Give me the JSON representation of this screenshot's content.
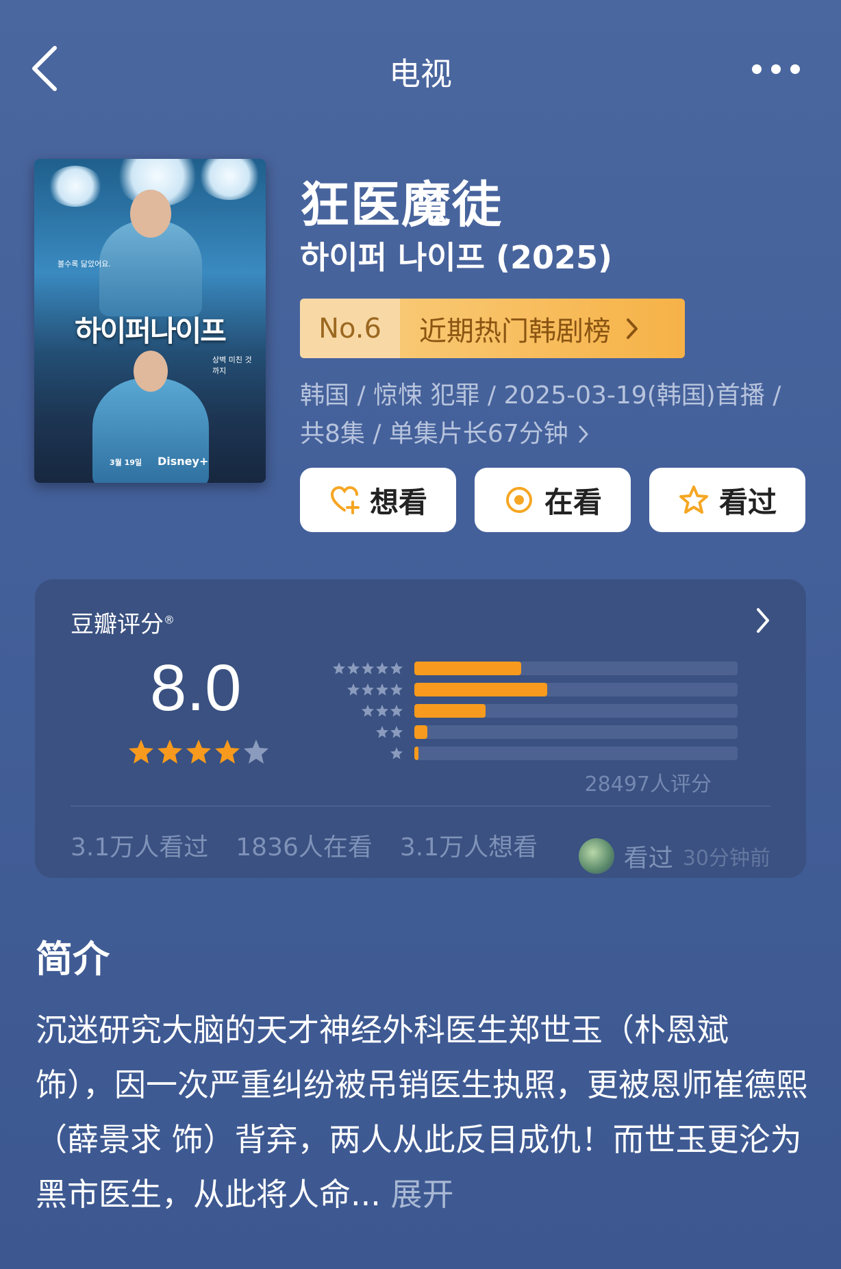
{
  "header": {
    "title": "电视"
  },
  "poster": {
    "title": "하이퍼나이프",
    "tagline_left": "볼수록 닮았어요.",
    "tagline_right": "상벽 미친 것까지",
    "date": "3월 19일",
    "brand": "Disney+"
  },
  "show": {
    "cn_title": "狂医魔徒",
    "original_title": "하이퍼 나이프 (2025)",
    "rank_no": "No.6",
    "rank_label": "近期热门韩剧榜",
    "meta_line1": "韩国 / 惊悚 犯罪 / 2025-03-19(韩国)首播 /",
    "meta_line2": "共8集 / 单集片长67分钟"
  },
  "actions": [
    {
      "label": "想看",
      "icon": "heart-plus-icon"
    },
    {
      "label": "在看",
      "icon": "target-icon"
    },
    {
      "label": "看过",
      "icon": "star-outline-icon"
    }
  ],
  "rating": {
    "label": "豆瓣评分",
    "mark": "®",
    "score": "8.0",
    "stars_filled": 4,
    "stars_total": 5,
    "distribution": [
      {
        "stars": 5,
        "fraction": 0.33
      },
      {
        "stars": 4,
        "fraction": 0.41
      },
      {
        "stars": 3,
        "fraction": 0.22
      },
      {
        "stars": 2,
        "fraction": 0.04
      },
      {
        "stars": 1,
        "fraction": 0.01
      }
    ],
    "count_text": "28497人评分",
    "stats": [
      "3.1万人看过",
      "1836人在看",
      "3.1万人想看"
    ],
    "recent_action": "看过",
    "recent_time": "30分钟前"
  },
  "intro": {
    "heading": "简介",
    "text": "沉迷研究大脑的天才神经外科医生郑世玉（朴恩斌 饰），因一次严重纠纷被吊销医生执照，更被恩师崔德熙（薛景求 饰）背弃，两人从此反目成仇！而世玉更沦为黑市医生，从此将人命...",
    "expand": "展开"
  },
  "colors": {
    "accent": "#f79a1d",
    "background": "#4b679f",
    "card": "#3a5181"
  }
}
